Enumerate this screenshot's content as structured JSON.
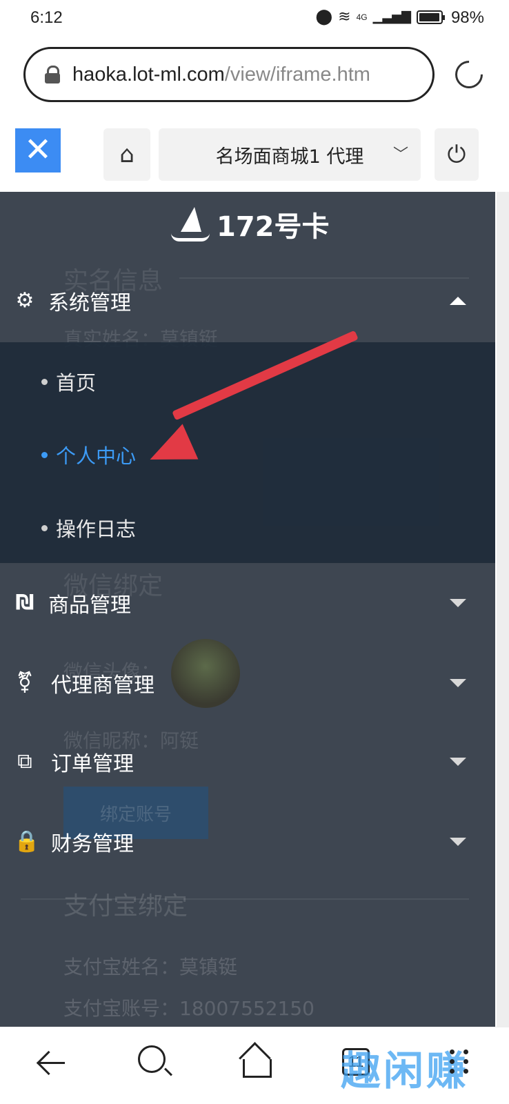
{
  "status_bar": {
    "time": "6:12",
    "signal_label": "4G",
    "battery": "98%"
  },
  "browser": {
    "url_host": "haoka.lot-ml.com",
    "url_path": "/view/iframe.htm"
  },
  "app_header": {
    "close_glyph": "✕",
    "shop_name": "名场面商城1 代理",
    "chevron": "﹀"
  },
  "logo": {
    "text": "172号卡"
  },
  "background_page": {
    "section_realname": "实名信息",
    "realname_row": "真实姓名：莫镇铤",
    "section_wechat": "微信绑定",
    "wechat_avatar_label": "微信头像：",
    "wechat_nickname": "微信昵称：阿铤",
    "bind_button": "绑定账号",
    "section_alipay": "支付宝绑定",
    "alipay_name": "支付宝姓名：莫镇铤",
    "alipay_account": "支付宝账号：18007552150"
  },
  "sidebar": {
    "groups": [
      {
        "label": "系统管理",
        "icon": "gear-icon",
        "expanded": true
      },
      {
        "label": "商品管理",
        "icon": "product-icon",
        "expanded": false
      },
      {
        "label": "代理商管理",
        "icon": "agent-icon",
        "expanded": false
      },
      {
        "label": "订单管理",
        "icon": "order-icon",
        "expanded": false
      },
      {
        "label": "财务管理",
        "icon": "lock-icon",
        "expanded": false
      }
    ],
    "system_items": [
      {
        "label": "首页",
        "active": false
      },
      {
        "label": "个人中心",
        "active": true
      },
      {
        "label": "操作日志",
        "active": false
      }
    ]
  },
  "bottom_nav": {
    "tab_count": "11",
    "watermark": "趣闲赚"
  },
  "colors": {
    "accent": "#3c8cf3",
    "active_item": "#3c9bf6",
    "sidebar_bg": "#2f3844",
    "submenu_bg": "#1e2b3a",
    "arrow": "#e23a45"
  }
}
